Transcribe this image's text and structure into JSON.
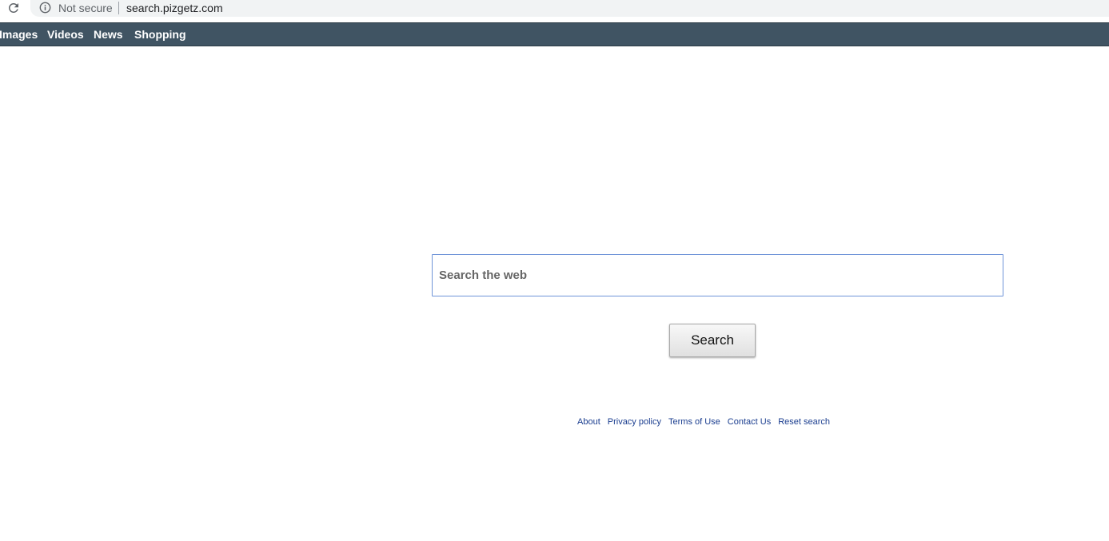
{
  "browser": {
    "security_label": "Not secure",
    "url": "search.pizgetz.com"
  },
  "nav": {
    "items": [
      {
        "label": "Images"
      },
      {
        "label": "Videos"
      },
      {
        "label": "News"
      },
      {
        "label": "Shopping"
      }
    ],
    "background": "#405463"
  },
  "search": {
    "placeholder": "Search the web",
    "button_label": "Search"
  },
  "footer": {
    "links": [
      {
        "label": "About"
      },
      {
        "label": "Privacy policy"
      },
      {
        "label": "Terms of Use"
      },
      {
        "label": "Contact Us"
      },
      {
        "label": "Reset search"
      }
    ],
    "link_color": "#1a3d8f"
  },
  "icons": {
    "reload": "reload-icon",
    "info": "info-icon"
  }
}
